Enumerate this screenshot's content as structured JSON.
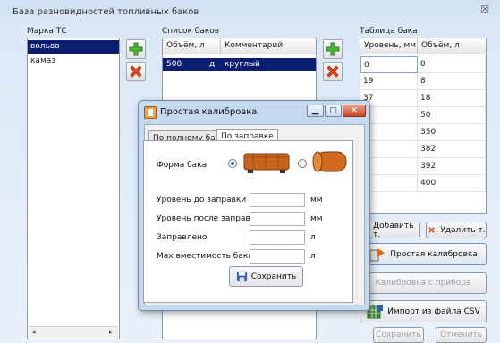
{
  "window": {
    "title": "База разновидностей топливных баков",
    "close_glyph": "☒"
  },
  "vehicles": {
    "label": "Марка ТС",
    "items": [
      "вольво",
      "камаз"
    ]
  },
  "tanks": {
    "label": "Список баков",
    "columns": [
      "Объём, л",
      "Комментарий"
    ],
    "rows": [
      {
        "volume": "500",
        "unit": "д",
        "comment": "круглый"
      }
    ]
  },
  "table": {
    "label": "Таблица бака",
    "columns": [
      "Уровень, мм",
      "Объём, л"
    ],
    "levels": [
      "0",
      "19",
      "37",
      "",
      "",
      "",
      "",
      ""
    ],
    "volumes": [
      "0",
      "8",
      "18",
      "50",
      "350",
      "382",
      "392",
      "400"
    ]
  },
  "buttons": {
    "add_point": "Добавить т.",
    "delete_point": "Удалить т.",
    "simple_calibration": "Простая калибровка",
    "device_calibration": "Калибровка с прибора",
    "import_csv": "Импорт из файла CSV",
    "save": "Сохранить",
    "cancel": "Отменить"
  },
  "dialog": {
    "title": "Простая калибровка",
    "tabs": [
      "По полному баку",
      "По заправке"
    ],
    "shape_label": "Форма бака",
    "fields": [
      {
        "label": "Уровень до заправки",
        "value": "",
        "unit": "мм"
      },
      {
        "label": "Уровень после заправки",
        "value": "",
        "unit": "мм"
      },
      {
        "label": "Заправлено",
        "value": "",
        "unit": "л"
      },
      {
        "label": "Max вместимость бака",
        "value": "",
        "unit": "л"
      }
    ],
    "save_label": "Сохранить"
  },
  "colors": {
    "selection": "#0b1d6e",
    "accent_blue": "#2d5fb0",
    "tank_orange": "#c9651a"
  }
}
